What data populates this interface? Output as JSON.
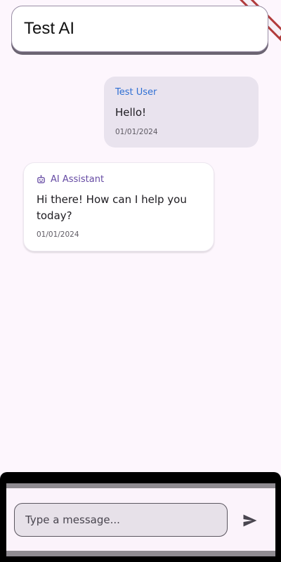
{
  "app_bar": {
    "title": "Test AI"
  },
  "messages": [
    {
      "sender": "Test User",
      "text": "Hello!",
      "timestamp": "01/01/2024"
    },
    {
      "sender": "AI Assistant",
      "text": "Hi there! How can I help you today?",
      "timestamp": "01/01/2024",
      "icon": "robot-icon"
    }
  ],
  "composer": {
    "placeholder": "Type a message...",
    "send_icon": "send-icon"
  },
  "colors": {
    "background": "#fdf6fd",
    "user_bubble": "#e9e3ee",
    "user_name": "#2f6fd3",
    "ai_name": "#654aa3",
    "debug_banner": "#b13b3b"
  }
}
